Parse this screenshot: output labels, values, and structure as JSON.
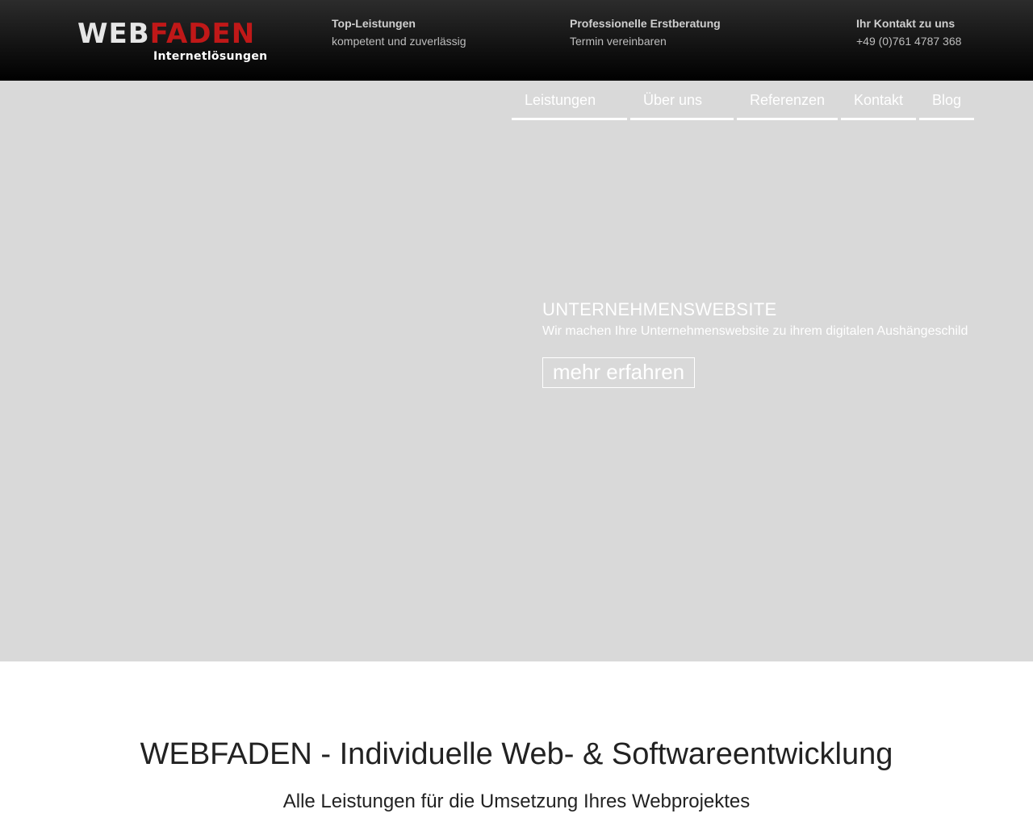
{
  "header": {
    "logo": {
      "web": "WEB",
      "faden": "FADEN",
      "subtitle": "Internetlösungen"
    },
    "info": [
      {
        "title": "Top-Leistungen",
        "subtitle": "kompetent und zuverlässig"
      },
      {
        "title": "Professionelle Erstberatung",
        "subtitle": "Termin vereinbaren"
      },
      {
        "title": "Ihr Kontakt zu uns",
        "subtitle": "+49 (0)761 4787 368"
      }
    ]
  },
  "nav": {
    "items": [
      "Leistungen",
      "Über uns",
      "Referenzen",
      "Kontakt",
      "Blog"
    ]
  },
  "hero": {
    "title": "UNTERNEHMENSWEBSITE",
    "subtitle": "Wir machen Ihre Unternehmenswebsite zu ihrem digitalen Aushängeschild",
    "button": "mehr erfahren"
  },
  "main": {
    "title": "WEBFADEN - Individuelle Web- & Softwareentwicklung",
    "subtitle": "Alle Leistungen für die Umsetzung Ihres Webprojektes"
  },
  "colors": {
    "header_bg": "#111111",
    "logo_web": "#e6e6e6",
    "logo_faden": "#c01818",
    "hero_bg": "#d9d9d9"
  }
}
